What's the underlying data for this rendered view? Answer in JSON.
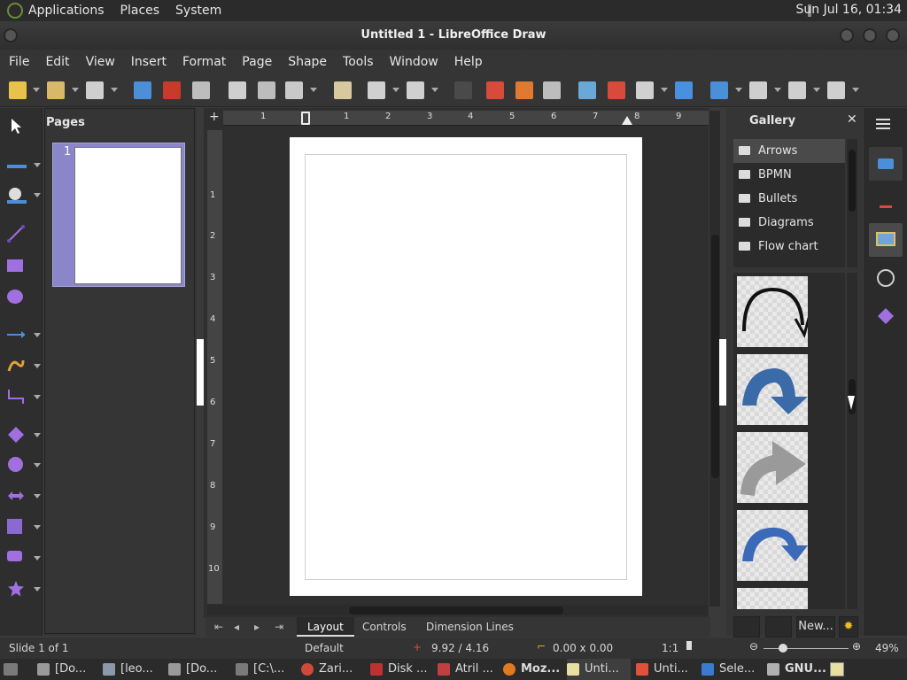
{
  "topbar": {
    "applications": "Applications",
    "places": "Places",
    "system": "System",
    "clock": "Sun Jul 16, 01:34"
  },
  "window": {
    "title": "Untitled 1 - LibreOffice Draw"
  },
  "menubar": [
    "File",
    "Edit",
    "View",
    "Insert",
    "Format",
    "Page",
    "Shape",
    "Tools",
    "Window",
    "Help"
  ],
  "pages_panel": {
    "title": "Pages",
    "page_number": "1"
  },
  "ruler": {
    "h_ticks": [
      "1",
      "1",
      "2",
      "3",
      "4",
      "5",
      "6",
      "7",
      "8",
      "9"
    ],
    "v_ticks": [
      "1",
      "2",
      "3",
      "4",
      "5",
      "6",
      "7",
      "8",
      "9",
      "10"
    ]
  },
  "tabs": {
    "layout": "Layout",
    "controls": "Controls",
    "dimension_lines": "Dimension Lines"
  },
  "gallery": {
    "title": "Gallery",
    "themes": [
      "Arrows",
      "BPMN",
      "Bullets",
      "Diagrams",
      "Flow chart"
    ],
    "selected_theme": "Arrows",
    "new_button": "New..."
  },
  "status": {
    "slide": "Slide 1 of 1",
    "master": "Default",
    "position": "9.92 / 4.16",
    "size": "0.00 x 0.00",
    "scale": "1:1",
    "zoom": "49%"
  },
  "taskbar": [
    {
      "label": "[Do...",
      "icon": "folder-icon",
      "color": "#9a9a9a"
    },
    {
      "label": "[leo...",
      "icon": "terminal-icon",
      "color": "#8a9aa8"
    },
    {
      "label": "[Do...",
      "icon": "folder-icon",
      "color": "#9a9a9a"
    },
    {
      "label": "[C:\\...",
      "icon": "terminal-icon",
      "color": "#7a7a7a"
    },
    {
      "label": "Zari...",
      "icon": "chrome-icon",
      "color": "#d04a3a"
    },
    {
      "label": "Disk ...",
      "icon": "disk-icon",
      "color": "#c03030"
    },
    {
      "label": "Atril ...",
      "icon": "document-viewer-icon",
      "color": "#c23f3f"
    },
    {
      "label": "Moz...",
      "icon": "firefox-icon",
      "color": "#e07a20"
    },
    {
      "label": "Unti...",
      "icon": "libreoffice-draw-icon",
      "color": "#e8e0a0"
    },
    {
      "label": "Unti...",
      "icon": "libreoffice-doc-icon",
      "color": "#e0503a"
    },
    {
      "label": "Sele...",
      "icon": "window-icon",
      "color": "#3a7ad0"
    },
    {
      "label": "GNU...",
      "icon": "gnu-icon",
      "color": "#b0b0b0"
    }
  ]
}
